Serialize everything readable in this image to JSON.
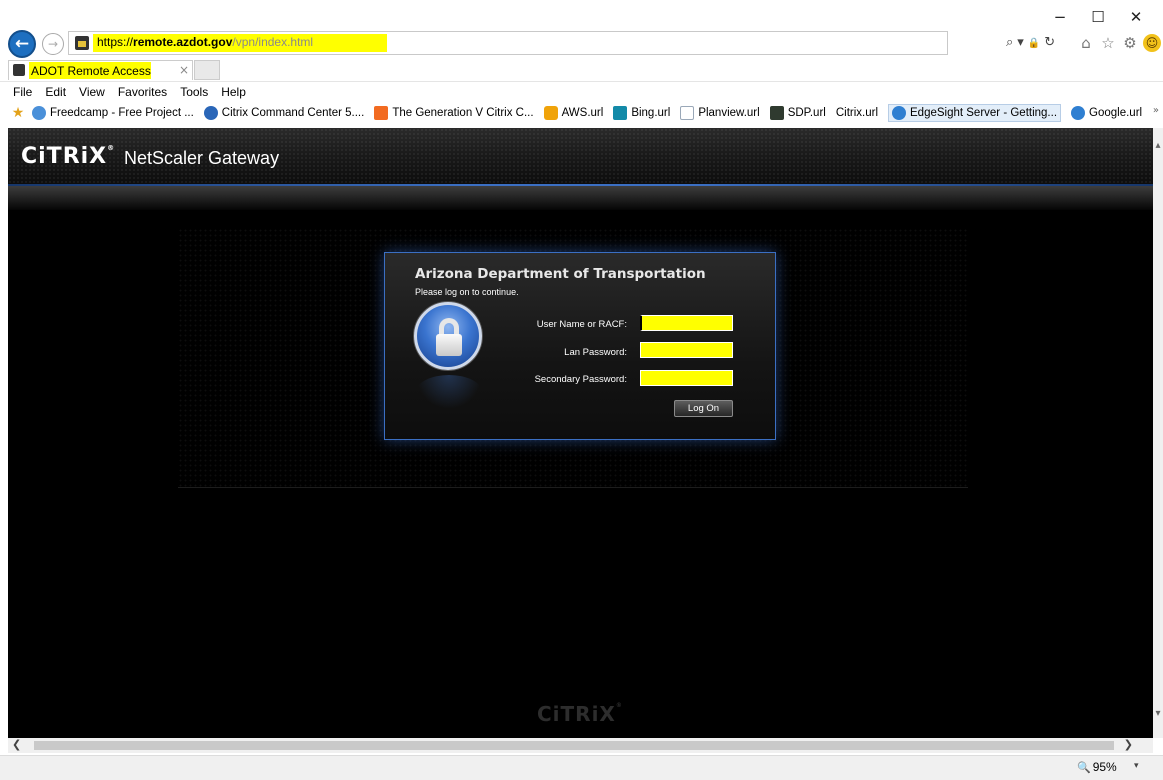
{
  "window": {
    "minimize_glyph": "−",
    "maximize_glyph": "☐",
    "close_glyph": "✕"
  },
  "nav": {
    "back_glyph": "←",
    "forward_glyph": "→",
    "url_proto": "https://",
    "url_host": "remote.azdot.gov",
    "url_path": "/vpn/index.html",
    "search_glyph": "⌕",
    "dropdown_glyph": "▾",
    "lock_glyph": "🔒",
    "refresh_glyph": "↻",
    "home_glyph": "⌂",
    "favorites_glyph": "☆",
    "tools_glyph": "⚙",
    "smiley_glyph": "☺"
  },
  "tab": {
    "title": "ADOT Remote Access",
    "close_glyph": "×"
  },
  "menu": {
    "items": [
      "File",
      "Edit",
      "View",
      "Favorites",
      "Tools",
      "Help"
    ]
  },
  "favorites_bar": {
    "star_glyph": "★",
    "chevron_glyph": "»",
    "items": [
      {
        "label": "Freedcamp - Free Project ...",
        "icon": "freedcamp-icon",
        "color": "#4a90d9"
      },
      {
        "label": "Citrix Command Center 5....",
        "icon": "citrix-icon",
        "color": "#2a66b8"
      },
      {
        "label": "The Generation V Citrix C...",
        "icon": "blogger-icon",
        "color": "#f26b21"
      },
      {
        "label": "AWS.url",
        "icon": "aws-icon",
        "color": "#f0a30a"
      },
      {
        "label": "Bing.url",
        "icon": "bing-icon",
        "color": "#138aa8"
      },
      {
        "label": "Planview.url",
        "icon": "planview-icon",
        "color": "#9aa8b8"
      },
      {
        "label": "SDP.url",
        "icon": "sdp-icon",
        "color": "#2f3a2f"
      },
      {
        "label": "Citrix.url",
        "icon": "",
        "color": ""
      },
      {
        "label": "EdgeSight Server - Getting...",
        "icon": "ie-icon",
        "color": "#2f7fd1"
      },
      {
        "label": "Google.url",
        "icon": "ie-icon",
        "color": "#2f7fd1"
      }
    ]
  },
  "gateway": {
    "brand": "CiTRiX",
    "product": "NetScaler Gateway",
    "org_title": "Arizona Department of Transportation",
    "prompt": "Please log on to continue.",
    "fields": {
      "user_label": "User Name or RACF:",
      "lan_label": "Lan Password:",
      "secondary_label": "Secondary Password:",
      "user_value": "",
      "lan_value": "",
      "secondary_value": ""
    },
    "logon_label": "Log On",
    "footer_brand": "CiTRiX"
  },
  "scrollbars": {
    "up_glyph": "▴",
    "down_glyph": "▾",
    "left_glyph": "❮",
    "right_glyph": "❯"
  },
  "status": {
    "zoom": "95%",
    "zoom_glyph": "🔍",
    "caret_glyph": "▾"
  },
  "colors": {
    "highlight": "#ffff00",
    "accent_blue": "#3b6fc3",
    "back_button": "#1d6fc0"
  }
}
